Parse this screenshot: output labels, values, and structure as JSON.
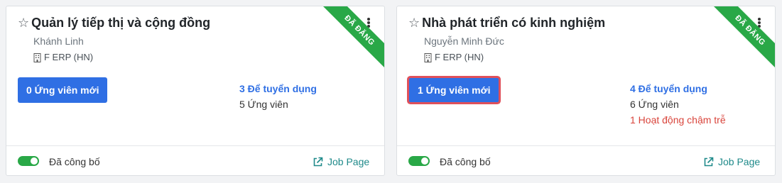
{
  "cards": [
    {
      "title": "Quản lý tiếp thị và cộng đồng",
      "manager": "Khánh Linh",
      "company": "F ERP (HN)",
      "new_applicants": "0 Ứng viên mới",
      "to_recruit": "3 Để tuyển dụng",
      "applicants": "5 Ứng viên",
      "late_activity": "",
      "ribbon": "ĐÃ ĐĂNG",
      "published_label": "Đã công bố",
      "published": true,
      "job_page_label": "Job Page"
    },
    {
      "title": "Nhà phát triển có kinh nghiệm",
      "manager": "Nguyễn Minh Đức",
      "company": "F ERP (HN)",
      "new_applicants": "1 Ứng viên mới",
      "to_recruit": "4 Để tuyển dụng",
      "applicants": "6 Ứng viên",
      "late_activity": "1 Hoạt động chậm trễ",
      "ribbon": "ĐÃ ĐĂNG",
      "published_label": "Đã công bố",
      "published": true,
      "job_page_label": "Job Page"
    }
  ],
  "colors": {
    "primary": "#2f6fe4",
    "ribbon": "#29a847",
    "toggle_on": "#29a847",
    "late": "#d9443b",
    "highlight": "#e0505a",
    "link": "#1f8a8a"
  },
  "icons": {
    "favorite": "star-outline-icon",
    "menu": "kebab-menu-icon",
    "company": "building-icon",
    "external": "external-link-icon"
  }
}
